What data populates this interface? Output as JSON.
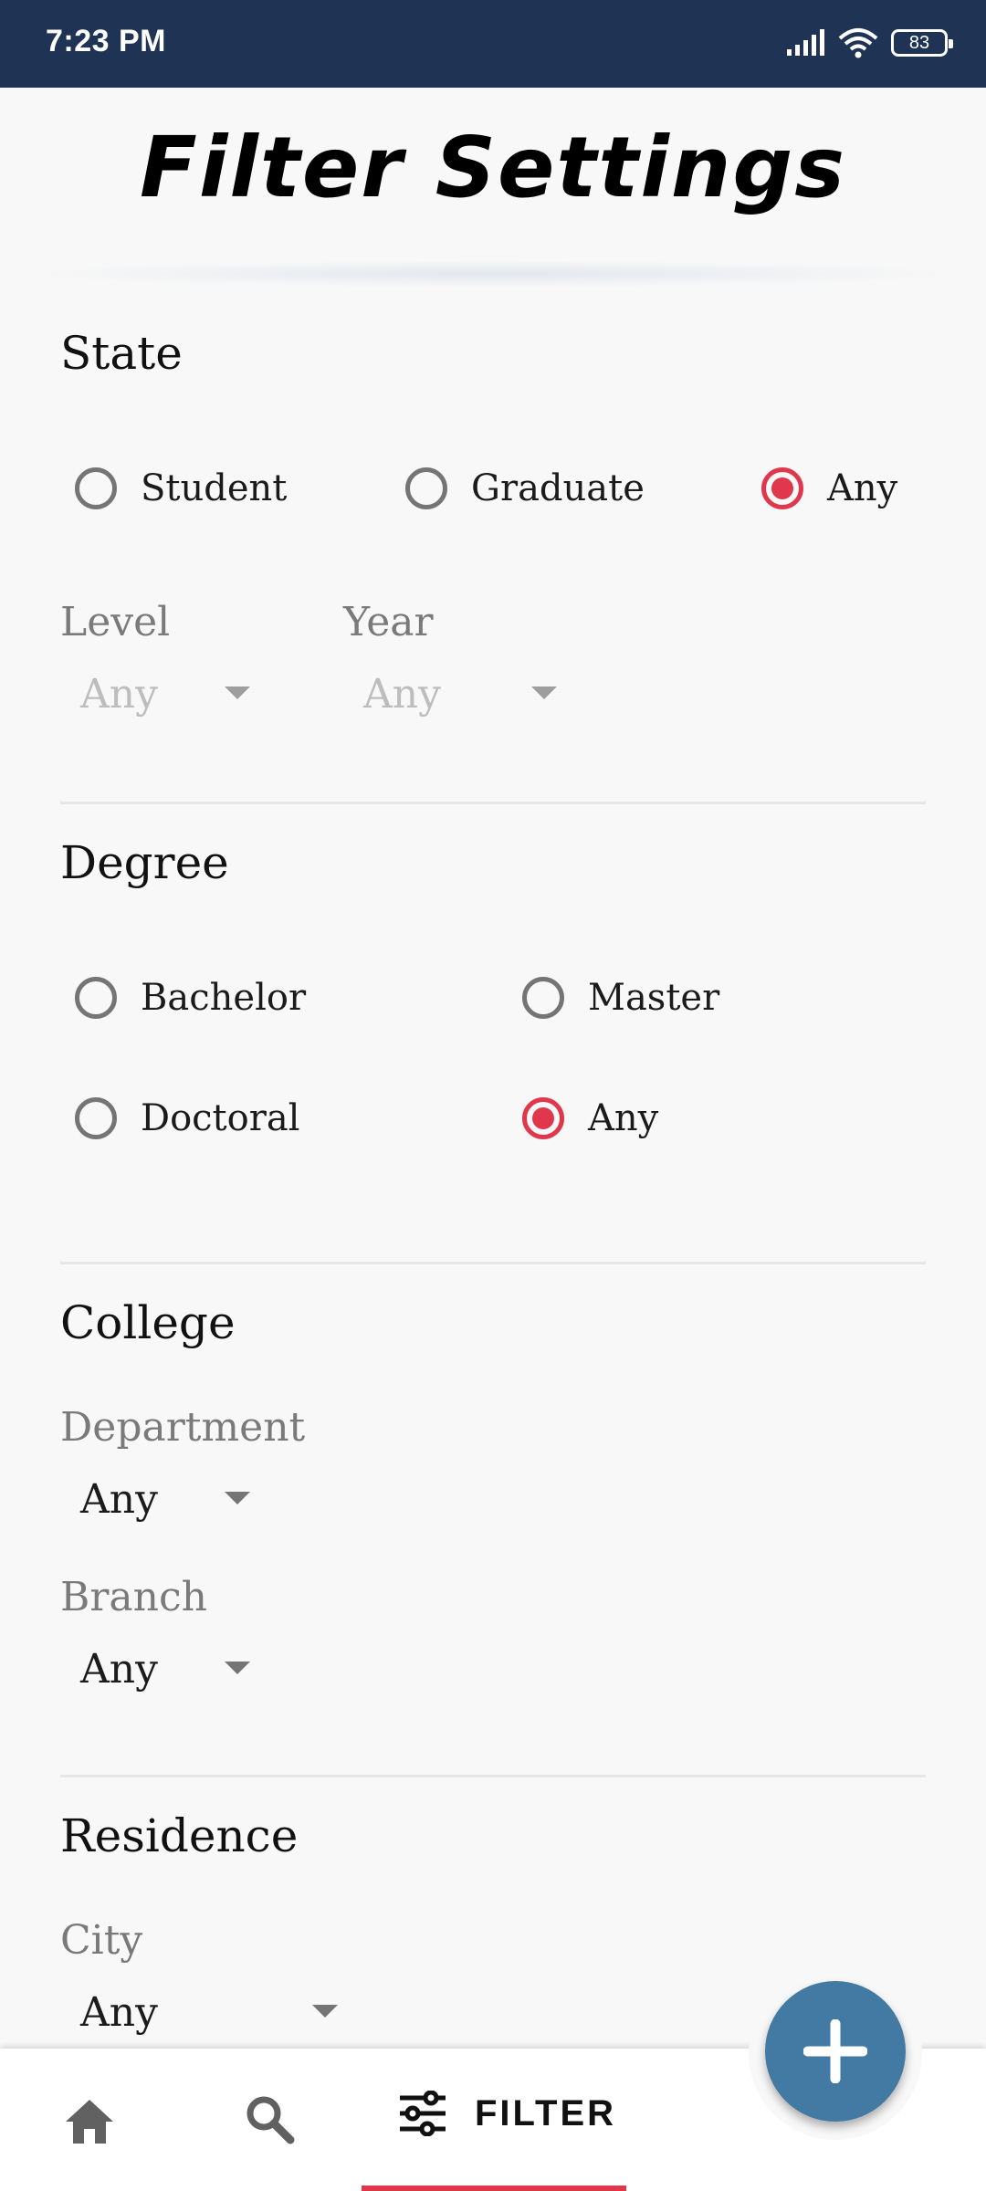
{
  "status_bar": {
    "time": "7:23 PM",
    "battery": "83"
  },
  "title": "Filter Settings",
  "state": {
    "title": "State",
    "options": [
      "Student",
      "Graduate",
      "Any"
    ],
    "selected": "Any",
    "level": {
      "label": "Level",
      "value": "Any"
    },
    "year": {
      "label": "Year",
      "value": "Any"
    }
  },
  "degree": {
    "title": "Degree",
    "options": [
      "Bachelor",
      "Master",
      "Doctoral",
      "Any"
    ],
    "selected": "Any"
  },
  "college": {
    "title": "College",
    "department": {
      "label": "Department",
      "value": "Any"
    },
    "branch": {
      "label": "Branch",
      "value": "Any"
    }
  },
  "residence": {
    "title": "Residence",
    "city": {
      "label": "City",
      "value": "Any"
    }
  },
  "bottom_nav": {
    "filter_label": "FILTER"
  },
  "colors": {
    "accent": "#e1374c",
    "fab": "#437aa3",
    "status_bar": "#1f3355"
  }
}
